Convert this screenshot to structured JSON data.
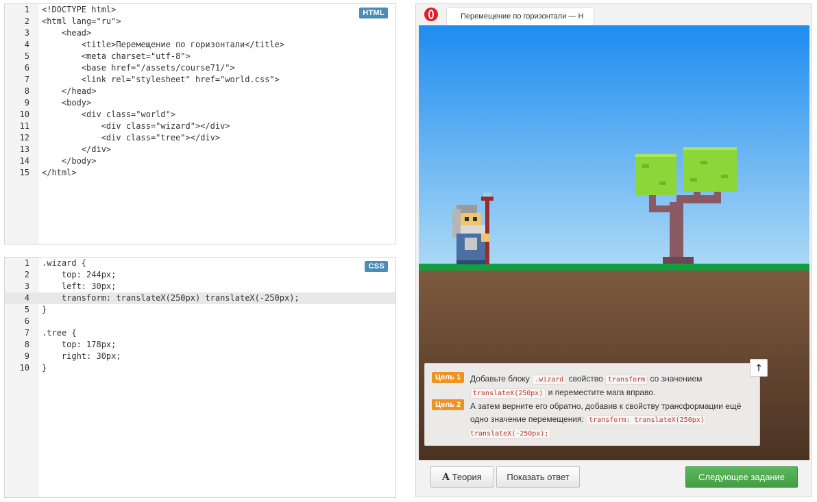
{
  "html_editor": {
    "badge": "HTML",
    "lines": [
      "<!DOCTYPE html>",
      "<html lang=\"ru\">",
      "    <head>",
      "        <title>Перемещение по горизонтали</title>",
      "        <meta charset=\"utf-8\">",
      "        <base href=\"/assets/course71/\">",
      "        <link rel=\"stylesheet\" href=\"world.css\">",
      "    </head>",
      "    <body>",
      "        <div class=\"world\">",
      "            <div class=\"wizard\"></div>",
      "            <div class=\"tree\"></div>",
      "        </div>",
      "    </body>",
      "</html>"
    ],
    "active_line": 1
  },
  "css_editor": {
    "badge": "CSS",
    "lines": [
      ".wizard {",
      "    top: 244px;",
      "    left: 30px;",
      "    transform: translateX(250px) translateX(-250px);",
      "}",
      "",
      ".tree {",
      "    top: 178px;",
      "    right: 30px;",
      "}"
    ],
    "active_line": 4
  },
  "browser": {
    "tab_title": "Перемещение по горизонтали — H",
    "icon": "opera-logo-icon"
  },
  "goals": [
    {
      "label": "Цель 1",
      "parts": [
        "Добавьте блоку ",
        {
          "code": ".wizard"
        },
        " свойство ",
        {
          "code": "transform"
        },
        " со значением ",
        {
          "code": "translateX(250px)"
        },
        " и переместите мага вправо."
      ]
    },
    {
      "label": "Цель 2",
      "parts": [
        "А затем верните его обратно, добавив к свойству трансформации ещё одно значение перемещения: ",
        {
          "code": "transform: translateX(250px) translateX(-250px);"
        }
      ]
    }
  ],
  "collapse_button": "🡑",
  "buttons": {
    "theory_icon": "A",
    "theory": "Теория",
    "answer": "Показать ответ",
    "next": "Следующее задание"
  },
  "colors": {
    "badge": "#4a8db7",
    "goal_label": "#f0931e",
    "next_button": "#5cb85c",
    "grass": "#10a040"
  }
}
